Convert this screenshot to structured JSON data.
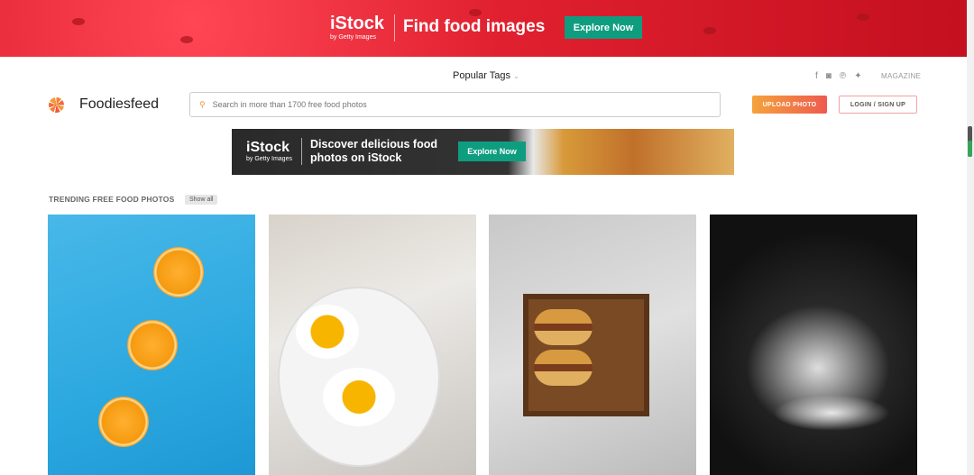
{
  "top_ad": {
    "brand": "iStock",
    "brand_sub": "by Getty Images",
    "headline": "Find food images",
    "cta": "Explore Now"
  },
  "header": {
    "popular_tags": "Popular Tags",
    "social": [
      {
        "icon": "facebook-icon",
        "glyph": "f"
      },
      {
        "icon": "instagram-icon",
        "glyph": "◙"
      },
      {
        "icon": "pinterest-icon",
        "glyph": "℗"
      },
      {
        "icon": "twitter-icon",
        "glyph": "🐦"
      }
    ],
    "magazine": "MAGAZINE",
    "brand": "Foodiesfeed",
    "search_placeholder": "Search in more than 1700 free food photos",
    "upload": "UPLOAD PHOTO",
    "login": "LOGIN / SIGN UP"
  },
  "mid_ad": {
    "brand": "iStock",
    "brand_sub": "by Getty Images",
    "headline_1": "Discover delicious food",
    "headline_2": "photos on iStock",
    "cta": "Explore Now"
  },
  "trending": {
    "title": "TRENDING FREE FOOD PHOTOS",
    "show_all": "Show all"
  },
  "colors": {
    "accent": "#ee5a4f",
    "istock_green": "#0f9d80"
  }
}
